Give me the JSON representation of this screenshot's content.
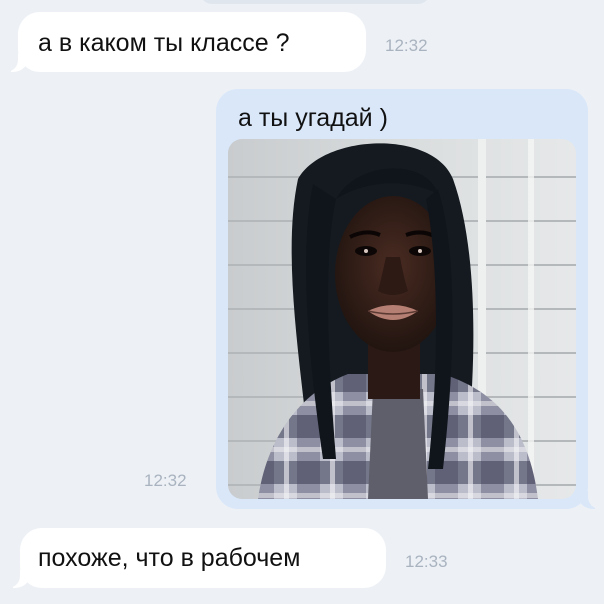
{
  "messages": [
    {
      "direction": "incoming",
      "text": "а в каком ты классе ?",
      "time": "12:32"
    },
    {
      "direction": "outgoing",
      "text": "а ты угадай )",
      "time": "12:32",
      "attachment": "photo"
    },
    {
      "direction": "incoming",
      "text": "похоже, что в рабочем",
      "time": "12:33"
    }
  ],
  "colors": {
    "background": "#edf1f6",
    "incoming_bubble": "#ffffff",
    "outgoing_bubble": "#d9e7f9",
    "timestamp": "#a9b3bf"
  }
}
